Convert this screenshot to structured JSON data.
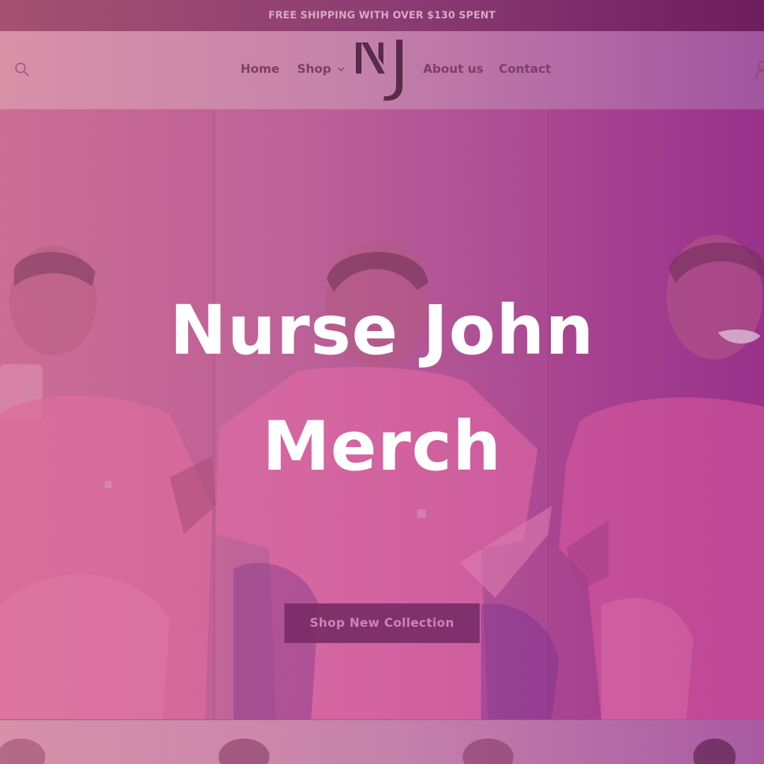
{
  "announcement": {
    "text": "FREE SHIPPING WITH OVER $130 SPENT"
  },
  "header": {
    "logo_icon": "nj-monogram-logo",
    "search_icon": "search-icon",
    "account_icon": "account-icon",
    "nav": [
      {
        "label": "Home"
      },
      {
        "label": "Shop",
        "has_dropdown": true,
        "icon": "chevron-down-icon"
      },
      {
        "label": "About us"
      },
      {
        "label": "Contact"
      }
    ]
  },
  "hero": {
    "title_line1": "Nurse John",
    "title_line2": "Merch",
    "cta_label": "Shop New Collection"
  },
  "colors": {
    "overlay_left": "#d891a7",
    "overlay_right": "#95328b",
    "cta_background": "#7a2d68",
    "nav_text": "#7e3f67",
    "title_text": "#ffffff"
  }
}
